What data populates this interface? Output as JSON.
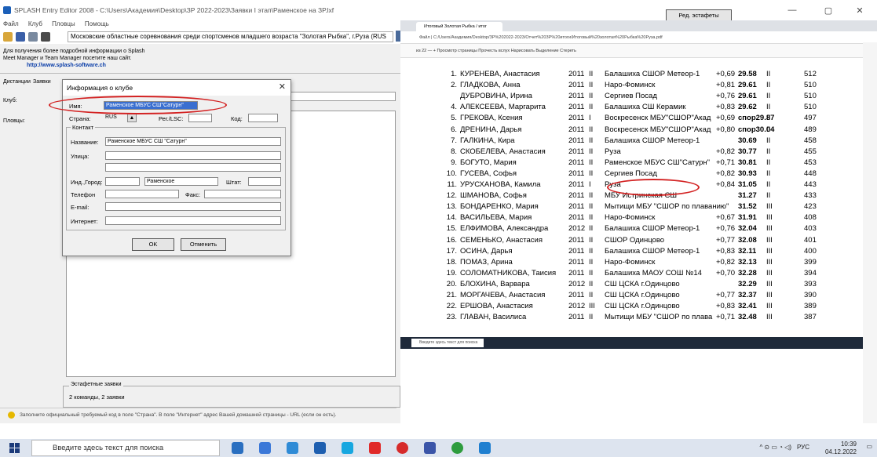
{
  "app": {
    "title": "SPLASH Entry Editor 2008 - C:\\Users\\Академия\\Desktop\\ЗР 2022-2023\\Заявки I этап\\Раменское на ЗР.lxf"
  },
  "menu": [
    "Файл",
    "Клуб",
    "Пловцы",
    "Помощь"
  ],
  "toolbar": {
    "meet": "Московские областные соревнования среди спортсменов младшего возраста \"Золотая Рыбка\", г.Руза (RUS"
  },
  "info": {
    "line1": "Для получения более подробной информации о Splash",
    "line2": "Meet Manager и Team Manager посетите наш сайт.",
    "link": "http://www.splash-software.ch"
  },
  "left_tabs": {
    "distances": "Дистанции",
    "entries": "Заявки",
    "club": "Клуб:",
    "swimmers": "Пловцы:"
  },
  "dialog": {
    "title": "Информация о клубе",
    "name_label": "Имя:",
    "name_value": "Раменское МБУС СШ\"Сатурн\"",
    "country_label": "Страна:",
    "country_value": "RUS",
    "reg_label": "Рег./LSC:",
    "code_label": "Код:",
    "contact_group": "Контакт",
    "contact_name_label": "Название:",
    "contact_name_value": "Раменское МБУС СШ \"Сатурн\"",
    "street_label": "Улица:",
    "zip_city_label": "Инд.,Город:",
    "city_value": "Раменское",
    "state_label": "Штат:",
    "phone_label": "Телефон",
    "fax_label": "Факс:",
    "email_label": "E-mail:",
    "internet_label": "Интернет:",
    "ok": "OK",
    "cancel": "Отменить"
  },
  "relay": {
    "group": "Эстафетные заявки",
    "summary": "2 команды, 2 заявки",
    "button": "Ред. эстафеты"
  },
  "status": {
    "text": "Заполните официальный требуемый код в поле \"Страна\". В поле \"Интернет\" адрес Вашей домашней страницы - URL (если он есть)."
  },
  "browser": {
    "tab": "Итоговый Золотая Рыбка / итог",
    "address": "Файл | C:/Users/Академия/Desktop/ЗР%202022-2023/Отчет%20ЗР%20итоги/Итоговый%20золотая%20Рыбка%20Руза.pdf",
    "pdf_toolbar": "из 22   —   +   Просмотр страницы   Прочесть вслух   Нарисовать   Выделение   Стереть",
    "rows": [
      {
        "n": "1.",
        "name": "КУРЕНЕВА, Анастасия",
        "year": "2011",
        "rank": "II",
        "club": "Балашиха СШОР Метеор-1",
        "rt": "+0,69",
        "time": "29.58",
        "q": "II",
        "pts": "512"
      },
      {
        "n": "2.",
        "name": "ГЛАДКОВА, Анна",
        "year": "2011",
        "rank": "II",
        "club": "Наро-Фоминск",
        "rt": "+0,81",
        "time": "29.61",
        "q": "II",
        "pts": "510"
      },
      {
        "n": "",
        "name": "ДУБРОВИНА, Ирина",
        "year": "2011",
        "rank": "II",
        "club": "Сергиев Посад",
        "rt": "+0,76",
        "time": "29.61",
        "q": "II",
        "pts": "510"
      },
      {
        "n": "4.",
        "name": "АЛЕКСЕЕВА, Маргарита",
        "year": "2011",
        "rank": "II",
        "club": "Балашиха СШ Керамик",
        "rt": "+0,83",
        "time": "29.62",
        "q": "II",
        "pts": "510"
      },
      {
        "n": "5.",
        "name": "ГРЕКОВА, Ксения",
        "year": "2011",
        "rank": "I",
        "club": "Воскресенск МБУ\"СШОР\"Акад",
        "rt": "+0,69",
        "time": "спор29.87",
        "q": "II",
        "pts": "497"
      },
      {
        "n": "6.",
        "name": "ДРЕНИНА, Дарья",
        "year": "2011",
        "rank": "II",
        "club": "Воскресенск МБУ\"СШОР\"Акад",
        "rt": "+0,80",
        "time": "спор30.04",
        "q": "II",
        "pts": "489"
      },
      {
        "n": "7.",
        "name": "ГАЛКИНА, Кира",
        "year": "2011",
        "rank": "II",
        "club": "Балашиха СШОР Метеор-1",
        "rt": "",
        "time": "30.69",
        "q": "II",
        "pts": "458"
      },
      {
        "n": "8.",
        "name": "СКОБЕЛЕВА, Анастасия",
        "year": "2011",
        "rank": "II",
        "club": "Руза",
        "rt": "+0,82",
        "time": "30.77",
        "q": "II",
        "pts": "455"
      },
      {
        "n": "9.",
        "name": "БОГУТО, Мария",
        "year": "2011",
        "rank": "II",
        "club": "Раменское МБУС СШ\"Сатурн\"",
        "rt": "+0,71",
        "time": "30.81",
        "q": "II",
        "pts": "453"
      },
      {
        "n": "10.",
        "name": "ГУСЕВА, Софья",
        "year": "2011",
        "rank": "II",
        "club": "Сергиев Посад",
        "rt": "+0,82",
        "time": "30.93",
        "q": "II",
        "pts": "448"
      },
      {
        "n": "11.",
        "name": "УРУСХАНОВА, Камила",
        "year": "2011",
        "rank": "I",
        "club": "Руза",
        "rt": "+0,84",
        "time": "31.05",
        "q": "II",
        "pts": "443"
      },
      {
        "n": "12.",
        "name": "ШМАНОВА, Софья",
        "year": "2011",
        "rank": "II",
        "club": "МБУ Истринская СШ",
        "rt": "",
        "time": "31.27",
        "q": "II",
        "pts": "433"
      },
      {
        "n": "13.",
        "name": "БОНДАРЕНКО, Мария",
        "year": "2011",
        "rank": "II",
        "club": "Мытищи МБУ \"СШОР по плаванию\"",
        "rt": "",
        "time": "31.52",
        "q": "III",
        "pts": "423"
      },
      {
        "n": "14.",
        "name": "ВАСИЛЬЕВА, Мария",
        "year": "2011",
        "rank": "II",
        "club": "Наро-Фоминск",
        "rt": "+0,67",
        "time": "31.91",
        "q": "III",
        "pts": "408"
      },
      {
        "n": "15.",
        "name": "ЕЛФИМОВА, Александра",
        "year": "2012",
        "rank": "II",
        "club": "Балашиха СШОР Метеор-1",
        "rt": "+0,76",
        "time": "32.04",
        "q": "III",
        "pts": "403"
      },
      {
        "n": "16.",
        "name": "СЕМЕНЬКО, Анастасия",
        "year": "2011",
        "rank": "II",
        "club": "СШОР Одинцово",
        "rt": "+0,77",
        "time": "32.08",
        "q": "III",
        "pts": "401"
      },
      {
        "n": "17.",
        "name": "ОСИНА, Дарья",
        "year": "2011",
        "rank": "II",
        "club": "Балашиха СШОР Метеор-1",
        "rt": "+0,83",
        "time": "32.11",
        "q": "III",
        "pts": "400"
      },
      {
        "n": "18.",
        "name": "ПОМАЗ, Арина",
        "year": "2011",
        "rank": "II",
        "club": "Наро-Фоминск",
        "rt": "+0,82",
        "time": "32.13",
        "q": "III",
        "pts": "399"
      },
      {
        "n": "19.",
        "name": "СОЛОМАТНИКОВА, Таисия",
        "year": "2011",
        "rank": "II",
        "club": "Балашиха МАОУ СОШ №14",
        "rt": "+0,70",
        "time": "32.28",
        "q": "III",
        "pts": "394"
      },
      {
        "n": "20.",
        "name": "БЛОХИНА, Варвара",
        "year": "2012",
        "rank": "II",
        "club": "СШ ЦСКА г.Одинцово",
        "rt": "",
        "time": "32.29",
        "q": "III",
        "pts": "393"
      },
      {
        "n": "21.",
        "name": "МОРГАЧЕВА, Анастасия",
        "year": "2011",
        "rank": "II",
        "club": "СШ ЦСКА г.Одинцово",
        "rt": "+0,77",
        "time": "32.37",
        "q": "III",
        "pts": "390"
      },
      {
        "n": "22.",
        "name": "ЕРШОВА, Анастасия",
        "year": "2012",
        "rank": "III",
        "club": "СШ ЦСКА г.Одинцово",
        "rt": "+0,83",
        "time": "32.41",
        "q": "III",
        "pts": "389"
      },
      {
        "n": "23.",
        "name": "ГЛАВАН, Василиса",
        "year": "2011",
        "rank": "II",
        "club": "Мытищи МБУ \"СШОР по плава",
        "rt": "+0,71",
        "time": "32.48",
        "q": "III",
        "pts": "387"
      }
    ],
    "inner_search": "Введите здесь текст для поиска"
  },
  "taskbar": {
    "search": "Введите здесь текст для поиска",
    "lang": "РУС",
    "time": "10:39",
    "date": "04.12.2022"
  }
}
